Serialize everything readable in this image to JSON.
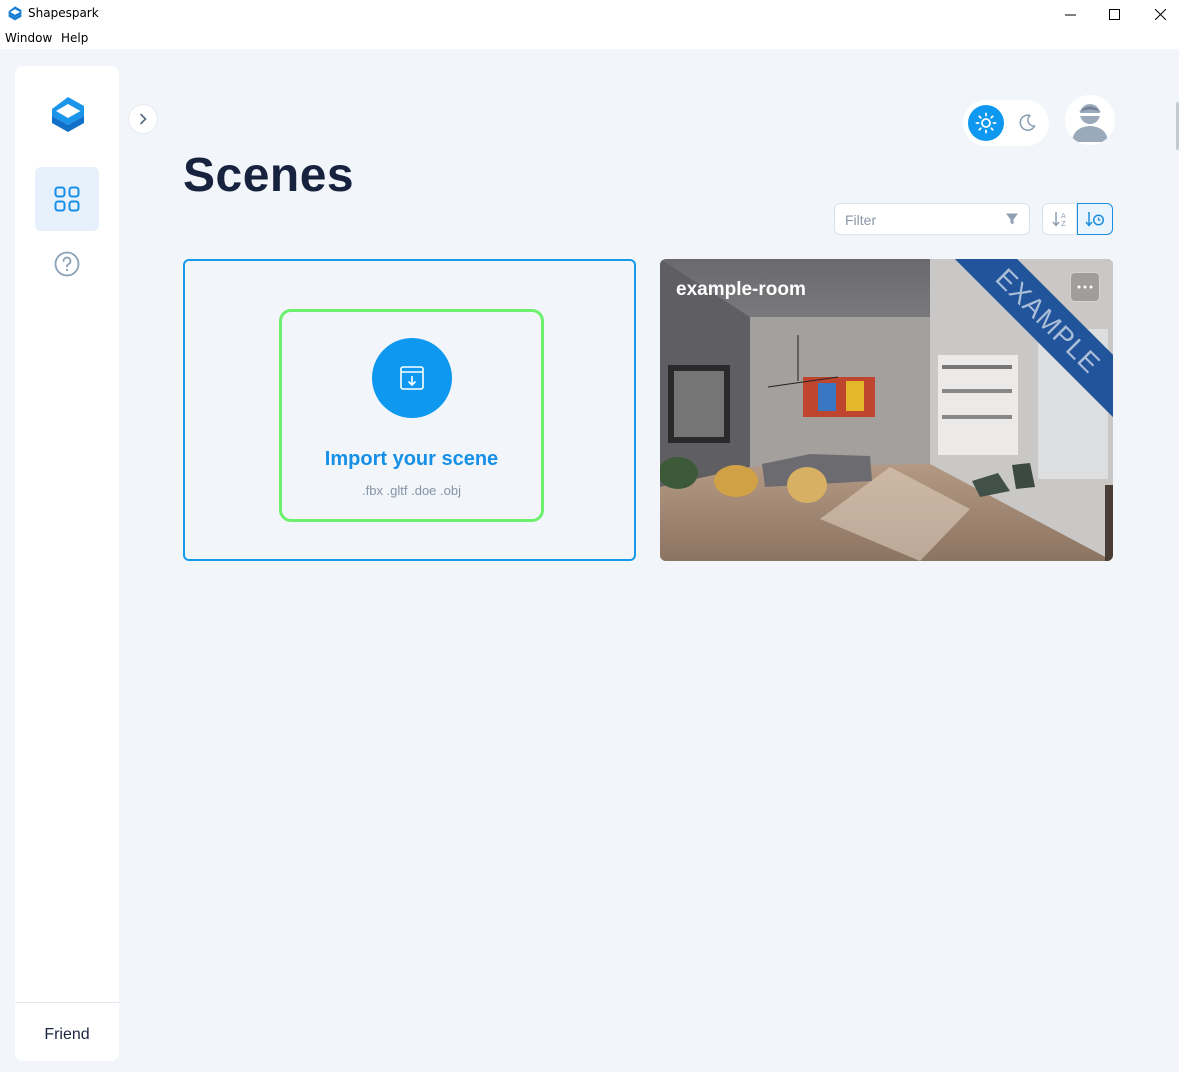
{
  "window": {
    "title": "Shapespark",
    "menu": [
      "Window",
      "Help"
    ]
  },
  "sidebar": {
    "user_name": "Friend"
  },
  "page": {
    "title": "Scenes"
  },
  "filter": {
    "placeholder": "Filter"
  },
  "import_card": {
    "label": "Import your scene",
    "formats": ".fbx .gltf .doe .obj"
  },
  "scenes": [
    {
      "name": "example-room",
      "badge": "EXAMPLE"
    }
  ],
  "colors": {
    "accent": "#0e98f0",
    "import_border": "#159be8",
    "highlight_border": "#6cf06e",
    "ribbon": "#21549a",
    "title": "#17223f"
  }
}
